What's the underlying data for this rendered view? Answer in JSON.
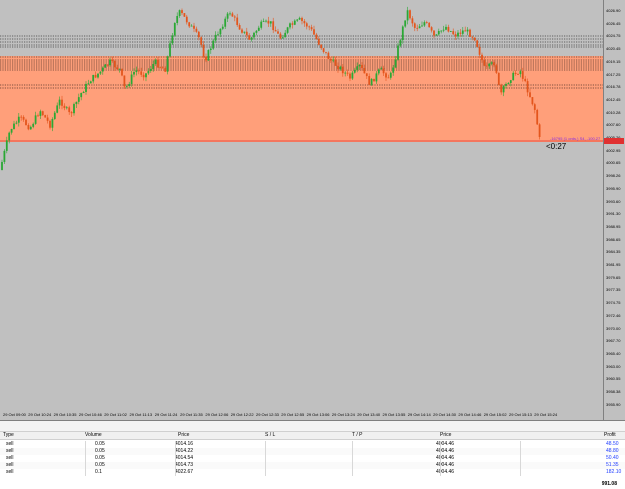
{
  "chart": {
    "timer": "<0:27",
    "position_label": "-16795 (1 ords.) S4, -100.27",
    "y_ticks": [
      "4026.90",
      "4026.45",
      "4024.75",
      "4020.45",
      "4019.15",
      "4017.25",
      "4016.78",
      "4012.45",
      "4010.28",
      "4007.60",
      "4005.26",
      "4002.95",
      "4000.65",
      "3998.26",
      "3995.90",
      "3993.60",
      "3991.30",
      "3988.95",
      "3986.65",
      "3984.35",
      "3981.95",
      "3979.65",
      "3977.35",
      "3974.75",
      "3972.46",
      "3970.00",
      "3967.70",
      "3965.40",
      "3963.00",
      "3960.55",
      "3958.38",
      "3955.90"
    ],
    "x_ticks": [
      "29 Oct 09:00",
      "29 Oct 10:24",
      "29 Oct 10:35",
      "29 Oct 10:46",
      "29 Oct 11:02",
      "29 Oct 11:13",
      "29 Oct 11:24",
      "29 Oct 11:35",
      "29 Oct 12:06",
      "29 Oct 12:22",
      "29 Oct 12:33",
      "29 Oct 12:55",
      "29 Oct 13:06",
      "29 Oct 13:24",
      "29 Oct 13:40",
      "29 Oct 13:55",
      "29 Oct 14:14",
      "29 Oct 14:30",
      "29 Oct 14:46",
      "29 Oct 15:02",
      "29 Oct 15:13",
      "29 Oct 15:24"
    ],
    "colors": {
      "bg": "#c0c0c0",
      "up": "#2aa834",
      "down": "#e4551c",
      "zone": "#ff9f7a",
      "line": "#000000"
    }
  },
  "panel": {
    "headers": {
      "type": "Type",
      "volume": "Volume",
      "price": "Price",
      "sl": "S / L",
      "tp": "T / P",
      "current": "Price",
      "profit": "Profit"
    },
    "rows": [
      {
        "type": "sell",
        "volume": "0.05",
        "price": "4014.16",
        "current": "4004.46",
        "profit": "48.50"
      },
      {
        "type": "sell",
        "volume": "0.05",
        "price": "4014.22",
        "current": "4004.46",
        "profit": "48.80"
      },
      {
        "type": "sell",
        "volume": "0.05",
        "price": "4014.54",
        "current": "4004.46",
        "profit": "50.40"
      },
      {
        "type": "sell",
        "volume": "0.05",
        "price": "4014.73",
        "current": "4004.46",
        "profit": "51.35"
      },
      {
        "type": "sell",
        "volume": "0.1",
        "price": "4022.67",
        "current": "4004.46",
        "profit": "182.10"
      }
    ],
    "total": "991.08"
  }
}
